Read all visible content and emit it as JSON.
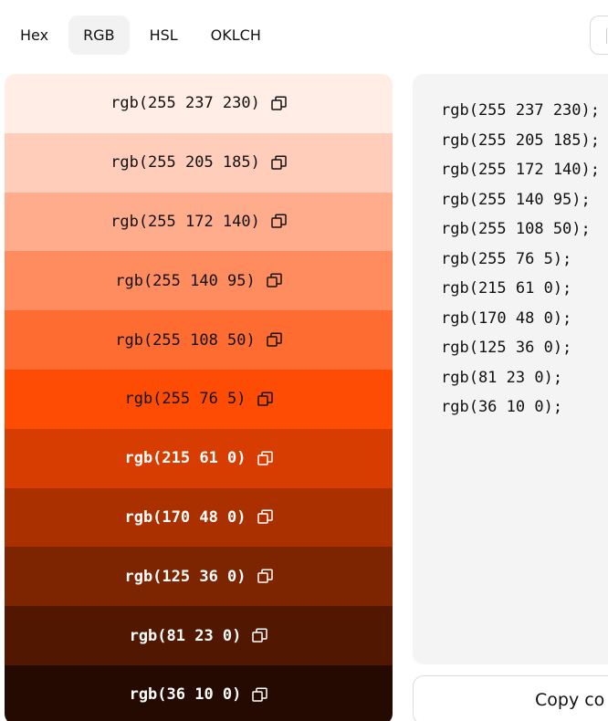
{
  "tabs": [
    {
      "label": "Hex",
      "active": false
    },
    {
      "label": "RGB",
      "active": true
    },
    {
      "label": "HSL",
      "active": false
    },
    {
      "label": "OKLCH",
      "active": false
    }
  ],
  "swatches": [
    {
      "label": "rgb(255 237 230)",
      "color": "#ffede6",
      "text_color": "#111111",
      "dark": false
    },
    {
      "label": "rgb(255 205 185)",
      "color": "#ffcdb9",
      "text_color": "#111111",
      "dark": false
    },
    {
      "label": "rgb(255 172 140)",
      "color": "#ffac8c",
      "text_color": "#111111",
      "dark": false
    },
    {
      "label": "rgb(255 140 95)",
      "color": "#ff8c5f",
      "text_color": "#111111",
      "dark": false
    },
    {
      "label": "rgb(255 108 50)",
      "color": "#ff6c32",
      "text_color": "#111111",
      "dark": false
    },
    {
      "label": "rgb(255 76 5)",
      "color": "#ff4c05",
      "text_color": "#111111",
      "dark": false
    },
    {
      "label": "rgb(215 61 0)",
      "color": "#d73d00",
      "text_color": "#ffffff",
      "dark": true
    },
    {
      "label": "rgb(170 48 0)",
      "color": "#aa3000",
      "text_color": "#ffffff",
      "dark": true
    },
    {
      "label": "rgb(125 36 0)",
      "color": "#7d2400",
      "text_color": "#ffffff",
      "dark": true
    },
    {
      "label": "rgb(81 23 0)",
      "color": "#511700",
      "text_color": "#ffffff",
      "dark": true
    },
    {
      "label": "rgb(36 10 0)",
      "color": "#240a00",
      "text_color": "#ffffff",
      "dark": true
    }
  ],
  "code_lines": [
    "rgb(255 237 230);",
    "rgb(255 205 185);",
    "rgb(255 172 140);",
    "rgb(255 140 95);",
    "rgb(255 108 50);",
    "rgb(255 76 5);",
    "rgb(215 61 0);",
    "rgb(170 48 0);",
    "rgb(125 36 0);",
    "rgb(81 23 0);",
    "rgb(36 10 0);"
  ],
  "copy_button_label": "Copy co",
  "icons": {
    "copy": "copy-icon"
  }
}
